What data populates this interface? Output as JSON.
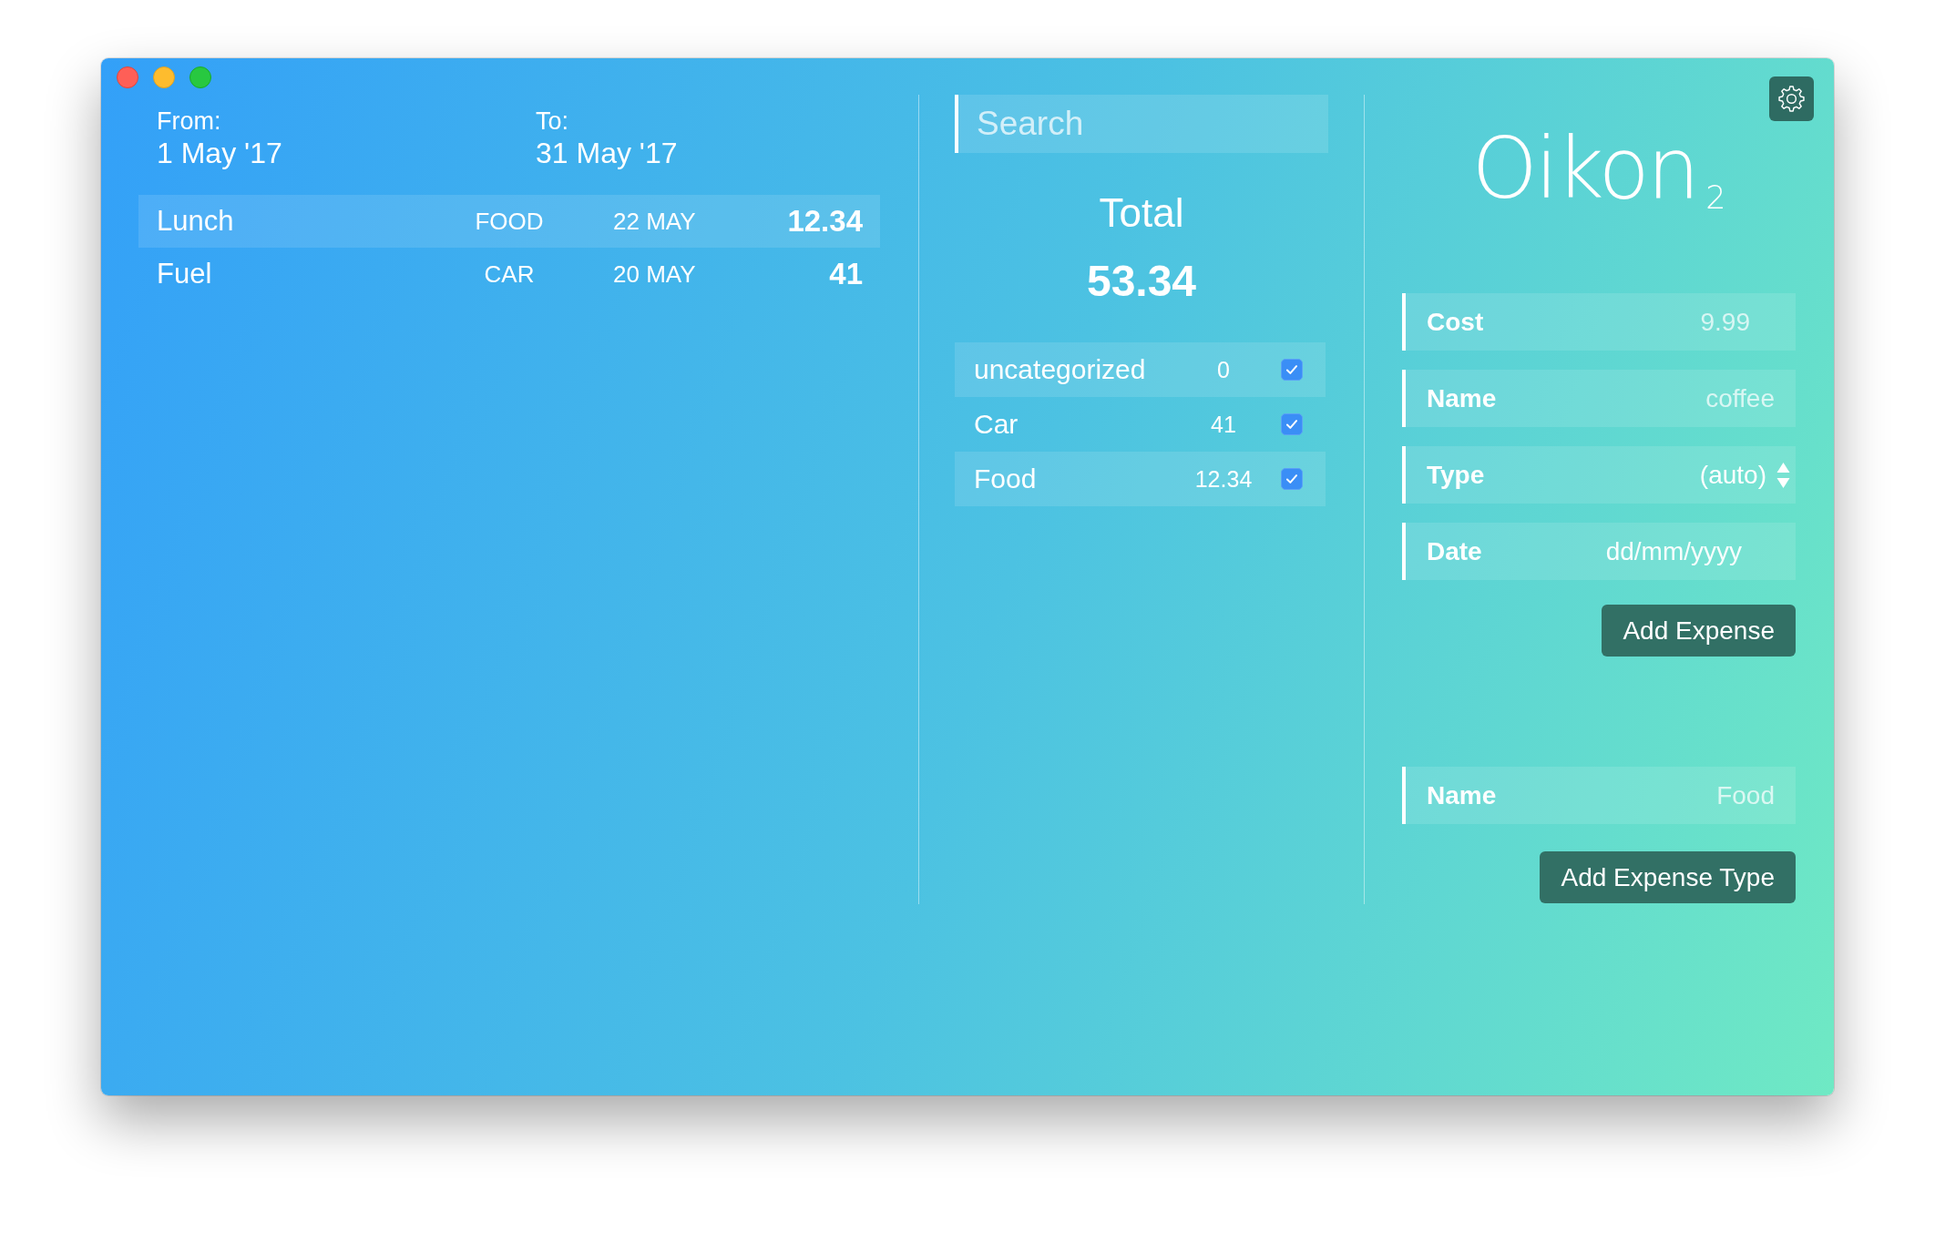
{
  "date_range": [
    {
      "label": "From:",
      "value": "1 May '17"
    },
    {
      "label": "To:",
      "value": "31 May '17"
    }
  ],
  "expenses": [
    {
      "name": "Lunch",
      "category": "FOOD",
      "date": "22 MAY",
      "amount": "12.34"
    },
    {
      "name": "Fuel",
      "category": "CAR",
      "date": "20 MAY",
      "amount": "41"
    }
  ],
  "search": {
    "placeholder": "Search"
  },
  "total": {
    "label": "Total",
    "value": "53.34"
  },
  "categories": [
    {
      "name": "uncategorized",
      "amount": "0",
      "checked": true
    },
    {
      "name": "Car",
      "amount": "41",
      "checked": true
    },
    {
      "name": "Food",
      "amount": "12.34",
      "checked": true
    }
  ],
  "logo": "Oikon$_{2}$",
  "expense_form": {
    "fields": [
      {
        "kind": "number",
        "label": "Cost",
        "placeholder": "9.99"
      },
      {
        "kind": "text",
        "label": "Name",
        "placeholder": "coffee"
      },
      {
        "kind": "select",
        "label": "Type",
        "value": "(auto)"
      },
      {
        "kind": "date",
        "label": "Date",
        "placeholder": "dd/mm/yyyy"
      }
    ],
    "button": "Add Expense"
  },
  "type_form": {
    "fields": [
      {
        "kind": "text",
        "label": "Name",
        "placeholder": "Food"
      }
    ],
    "button": "Add Expense Type"
  }
}
